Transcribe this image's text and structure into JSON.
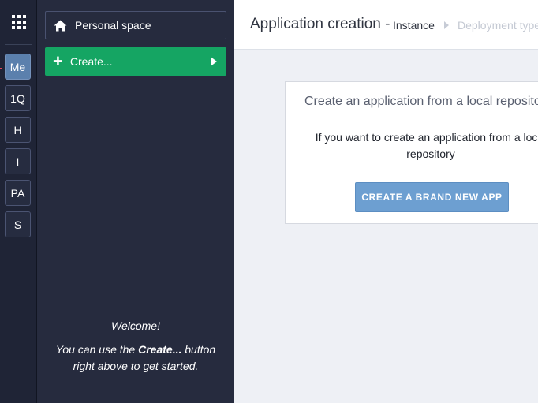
{
  "rail": {
    "workspaces": [
      {
        "label": "Me",
        "active": true
      },
      {
        "label": "1Q",
        "active": false
      },
      {
        "label": "H",
        "active": false
      },
      {
        "label": "I",
        "active": false
      },
      {
        "label": "PA",
        "active": false
      },
      {
        "label": "S",
        "active": false
      }
    ],
    "menu_icon": "grid-icon"
  },
  "panel": {
    "personal_space_label": "Personal space",
    "personal_space_icon": "home-icon",
    "create_label": "Create...",
    "welcome_title": "Welcome!",
    "welcome_text_prefix": "You can use the ",
    "welcome_text_bold": "Create...",
    "welcome_text_suffix": " button",
    "welcome_text_line2": "right above to get started."
  },
  "header": {
    "title": "Application creation -",
    "breadcrumb_current": "Instance",
    "breadcrumb_next": "Deployment type"
  },
  "card": {
    "title": "Create an application from a local repository",
    "text_line1": "If you want to create an application from a local",
    "text_line2": "repository",
    "button_label": "CREATE A BRAND NEW APP"
  },
  "colors": {
    "create_green": "#15a563",
    "active_workspace": "#5b80ad",
    "primary_button": "#6d9fd1"
  }
}
